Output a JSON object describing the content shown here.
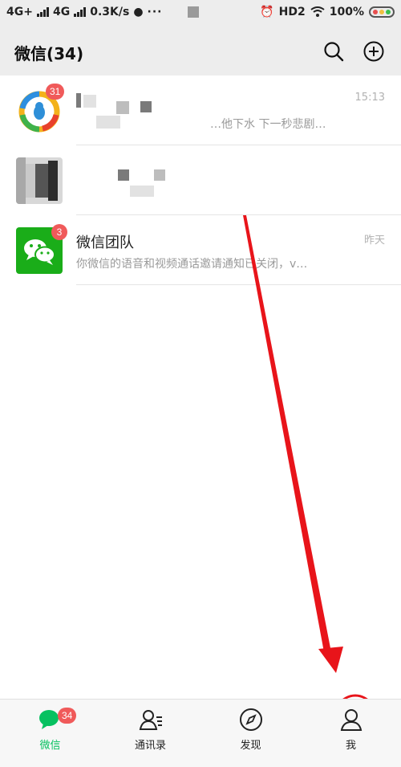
{
  "status_bar": {
    "network1": "4G+",
    "network2": "4G",
    "speed": "0.3K/s",
    "hd": "HD2",
    "battery": "100%"
  },
  "header": {
    "title": "微信(34)",
    "search_icon": "search-icon",
    "add_icon": "plus-circle-icon"
  },
  "chats": [
    {
      "name": "",
      "preview": "…他下水 下一秒悲剧…",
      "time": "15:13",
      "badge": "31",
      "avatar_icon": "qq-penguin-icon"
    },
    {
      "name": "",
      "preview": "",
      "time": "",
      "badge": "",
      "avatar_icon": "pixelated-avatar"
    },
    {
      "name": "微信团队",
      "preview": "你微信的语音和视频通话邀请通知已关闭，v…",
      "time": "昨天",
      "badge": "3",
      "avatar_icon": "wechat-logo-icon"
    }
  ],
  "tabs": [
    {
      "label": "微信",
      "badge": "34",
      "icon": "chat-bubbles-icon",
      "active": true
    },
    {
      "label": "通讯录",
      "icon": "contacts-icon",
      "active": false
    },
    {
      "label": "发现",
      "icon": "compass-icon",
      "active": false
    },
    {
      "label": "我",
      "icon": "person-icon",
      "active": false
    }
  ],
  "colors": {
    "accent_green": "#07c160",
    "badge_red": "#f05a5a",
    "annotation_red": "#e8141a"
  }
}
